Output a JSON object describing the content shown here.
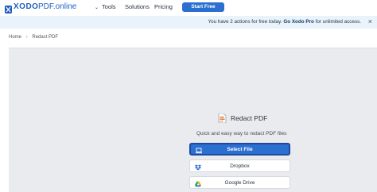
{
  "header": {
    "logo_text": "XODO",
    "logo_sub": "PDF.online",
    "nav": [
      {
        "label": "Tools"
      },
      {
        "label": "Solutions"
      },
      {
        "label": "Pricing"
      }
    ],
    "start_label": "Start Free"
  },
  "banner": {
    "prefix": "You have 2 actions for free today.",
    "link": "Go Xodo Pro",
    "suffix": "for unlimited access.",
    "close": "×"
  },
  "breadcrumb": {
    "home": "Home",
    "separator": "›",
    "current": "Redact PDF"
  },
  "tool": {
    "title": "Redact PDF",
    "subtitle": "Quick and easy way to redact PDF files",
    "buttons": {
      "select": "Select File",
      "dropbox": "Dropbox",
      "gdrive": "Google Drive"
    }
  },
  "colors": {
    "brand": "#1f5fbf",
    "primary_button": "#2b6fd1",
    "banner_bg": "#e8f3fb",
    "panel_bg": "#eaebee"
  }
}
